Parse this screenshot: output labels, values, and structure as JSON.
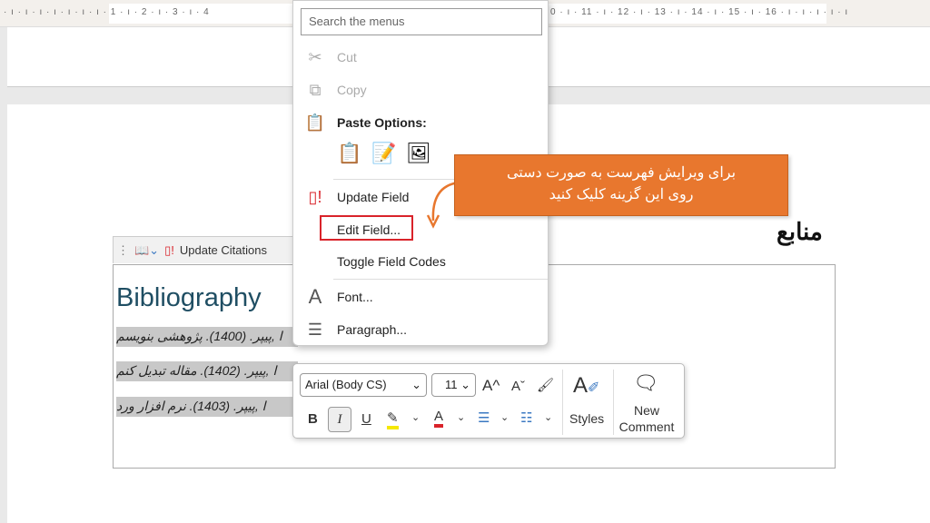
{
  "ruler": {
    "left_ticks": "· ı · ı · ı · ı · ı · ı · ı · 1 · ı · 2 · ı · 3 · ı · 4",
    "right_ticks": "0 · ı · 11 · ı · 12 · ı · 13 · ı · 14 · ı · 15 · ı · 16 · ı · ı · ı · ı · ı"
  },
  "document": {
    "heading": "منابع",
    "bib_title": "Bibliography",
    "entries": [
      "ا ,پیپر. (1400). پژوهشی بنویسم",
      "ا ,پیپر. (1402). مقاله تبدیل کنم",
      "ا ,پیپر. (1403). نرم افزار ورد"
    ]
  },
  "bib_toolbar": {
    "update_citations": "Update Citations"
  },
  "context_menu": {
    "search_placeholder": "Search the menus",
    "items": [
      {
        "label": "Cut",
        "icon": "scissors-icon",
        "disabled": true
      },
      {
        "label": "Copy",
        "icon": "copy-icon",
        "disabled": true
      },
      {
        "label": "Paste Options:",
        "icon": "clipboard-icon"
      },
      {
        "label": "Update Field",
        "icon": "update-field-icon"
      },
      {
        "label": "Edit Field...",
        "highlighted": true
      },
      {
        "label": "Toggle Field Codes"
      },
      {
        "label": "Font...",
        "icon": "font-icon"
      },
      {
        "label": "Paragraph...",
        "icon": "paragraph-icon"
      }
    ]
  },
  "callout": {
    "line1": "برای ویرایش فهرست به صورت دستی",
    "line2": "روی این گزینه کلیک کنید",
    "color": "#e8772e"
  },
  "mini_toolbar": {
    "font": "Arial (Body CS)",
    "size": "11",
    "grow": "A^",
    "shrink": "Aˇ",
    "bold": "B",
    "italic": "I",
    "underline": "U",
    "styles": "Styles",
    "new": "New",
    "comment": "Comment"
  },
  "colors": {
    "highlight": "#f5e800",
    "font_color": "#d9232a",
    "edit_box": "#d9232a"
  }
}
